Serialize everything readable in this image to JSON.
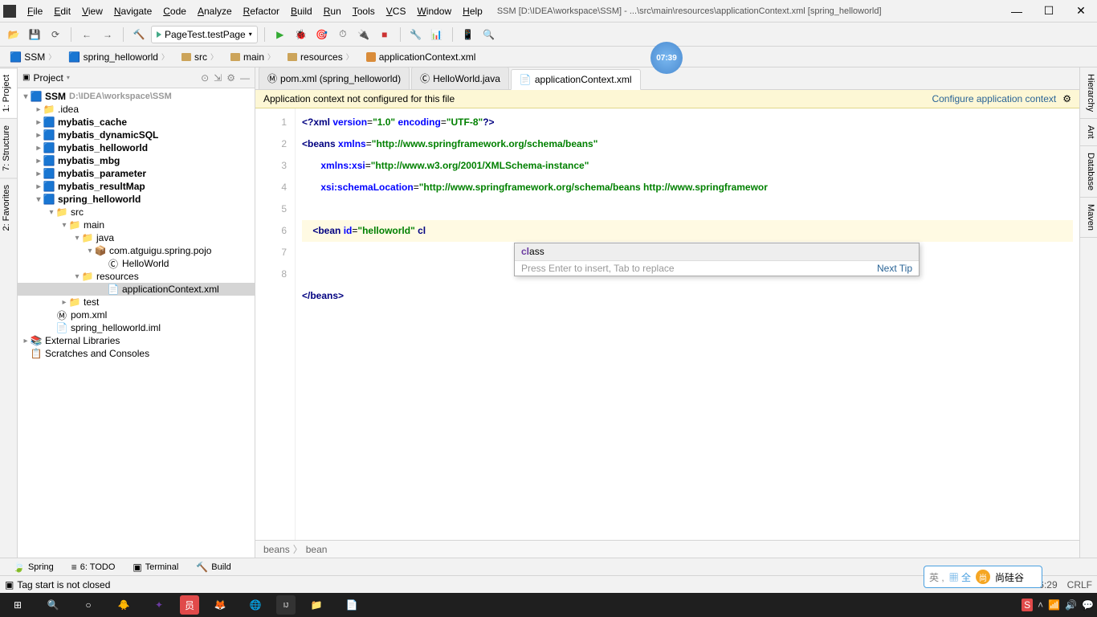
{
  "window": {
    "title": "SSM [D:\\IDEA\\workspace\\SSM] - ...\\src\\main\\resources\\applicationContext.xml [spring_helloworld]"
  },
  "menubar": [
    "File",
    "Edit",
    "View",
    "Navigate",
    "Code",
    "Analyze",
    "Refactor",
    "Build",
    "Run",
    "Tools",
    "VCS",
    "Window",
    "Help"
  ],
  "toolbar": {
    "run_config": "PageTest.testPage"
  },
  "navbar": [
    "SSM",
    "spring_helloworld",
    "src",
    "main",
    "resources",
    "applicationContext.xml"
  ],
  "left_tabs": [
    "1: Project",
    "7: Structure",
    "2: Favorites"
  ],
  "right_tabs": [
    "Hierarchy",
    "Ant",
    "Database",
    "Maven"
  ],
  "project_panel": {
    "title": "Project",
    "tree": [
      {
        "d": 0,
        "a": "▾",
        "ico": "prj",
        "txt": "SSM",
        "dim": "D:\\IDEA\\workspace\\SSM",
        "bold": true
      },
      {
        "d": 1,
        "a": "▸",
        "ico": "fld",
        "txt": ".idea"
      },
      {
        "d": 1,
        "a": "▸",
        "ico": "mod",
        "txt": "mybatis_cache",
        "bold": true
      },
      {
        "d": 1,
        "a": "▸",
        "ico": "mod",
        "txt": "mybatis_dynamicSQL",
        "bold": true
      },
      {
        "d": 1,
        "a": "▸",
        "ico": "mod",
        "txt": "mybatis_helloworld",
        "bold": true
      },
      {
        "d": 1,
        "a": "▸",
        "ico": "mod",
        "txt": "mybatis_mbg",
        "bold": true
      },
      {
        "d": 1,
        "a": "▸",
        "ico": "mod",
        "txt": "mybatis_parameter",
        "bold": true
      },
      {
        "d": 1,
        "a": "▸",
        "ico": "mod",
        "txt": "mybatis_resultMap",
        "bold": true
      },
      {
        "d": 1,
        "a": "▾",
        "ico": "mod",
        "txt": "spring_helloworld",
        "bold": true
      },
      {
        "d": 2,
        "a": "▾",
        "ico": "fld",
        "txt": "src"
      },
      {
        "d": 3,
        "a": "▾",
        "ico": "fld",
        "txt": "main"
      },
      {
        "d": 4,
        "a": "▾",
        "ico": "src",
        "txt": "java"
      },
      {
        "d": 5,
        "a": "▾",
        "ico": "pkg",
        "txt": "com.atguigu.spring.pojo"
      },
      {
        "d": 6,
        "a": " ",
        "ico": "cls",
        "txt": "HelloWorld"
      },
      {
        "d": 4,
        "a": "▾",
        "ico": "res",
        "txt": "resources"
      },
      {
        "d": 6,
        "a": " ",
        "ico": "xml",
        "txt": "applicationContext.xml",
        "sel": true
      },
      {
        "d": 3,
        "a": "▸",
        "ico": "fld",
        "txt": "test"
      },
      {
        "d": 2,
        "a": " ",
        "ico": "pom",
        "txt": "pom.xml"
      },
      {
        "d": 2,
        "a": " ",
        "ico": "iml",
        "txt": "spring_helloworld.iml"
      },
      {
        "d": 0,
        "a": "▸",
        "ico": "lib",
        "txt": "External Libraries"
      },
      {
        "d": 0,
        "a": " ",
        "ico": "scr",
        "txt": "Scratches and Consoles"
      }
    ]
  },
  "editor_tabs": [
    {
      "label": "pom.xml (spring_helloworld)",
      "ico": "pom"
    },
    {
      "label": "HelloWorld.java",
      "ico": "cls"
    },
    {
      "label": "applicationContext.xml",
      "ico": "xml",
      "active": true
    }
  ],
  "warning": {
    "msg": "Application context not configured for this file",
    "link": "Configure application context"
  },
  "code": {
    "lines": [
      {
        "n": 1,
        "html": "<span class='tag'>&lt;?xml</span> <span class='attr'>version</span>=<span class='str'>\"1.0\"</span> <span class='attr'>encoding</span>=<span class='str'>\"UTF-8\"</span><span class='tag'>?&gt;</span>"
      },
      {
        "n": 2,
        "html": "<span class='tag'>&lt;beans</span> <span class='attr'>xmlns</span>=<span class='str'>\"http://www.springframework.org/schema/beans\"</span>"
      },
      {
        "n": 3,
        "html": "       <span class='attr'>xmlns:xsi</span>=<span class='str'>\"http://www.w3.org/2001/XMLSchema-instance\"</span>"
      },
      {
        "n": 4,
        "html": "       <span class='attr'>xsi:schemaLocation</span>=<span class='str'>\"http://www.springframework.org/schema/beans http://www.springframewor</span>"
      },
      {
        "n": 5,
        "html": ""
      },
      {
        "n": 6,
        "hl": true,
        "html": "    <span class='tag'>&lt;bean</span> <span class='attr'>id</span>=<span class='str'>\"helloworld\"</span> <span class='cursor-typing'>cl</span>"
      },
      {
        "n": 7,
        "html": ""
      },
      {
        "n": 8,
        "html": "<span class='tag'>&lt;/beans&gt;</span>"
      }
    ]
  },
  "autocomplete": {
    "suggestion": "class",
    "match": "cl",
    "rest": "ass",
    "hint_left": "Press Enter to insert, Tab to replace",
    "hint_right": "Next Tip"
  },
  "breadcrumb": [
    "beans",
    "bean"
  ],
  "bottom_tabs": [
    {
      "label": "Spring",
      "ico": "🍃"
    },
    {
      "label": "6: TODO",
      "ico": "≡"
    },
    {
      "label": "Terminal",
      "ico": "▣"
    },
    {
      "label": "Build",
      "ico": "🔨"
    }
  ],
  "status": {
    "msg": "Tag start is not closed",
    "pos": "6:29",
    "enc": "CRLF"
  },
  "time_badge": "07:39",
  "ime": {
    "label": "尚硅谷"
  }
}
